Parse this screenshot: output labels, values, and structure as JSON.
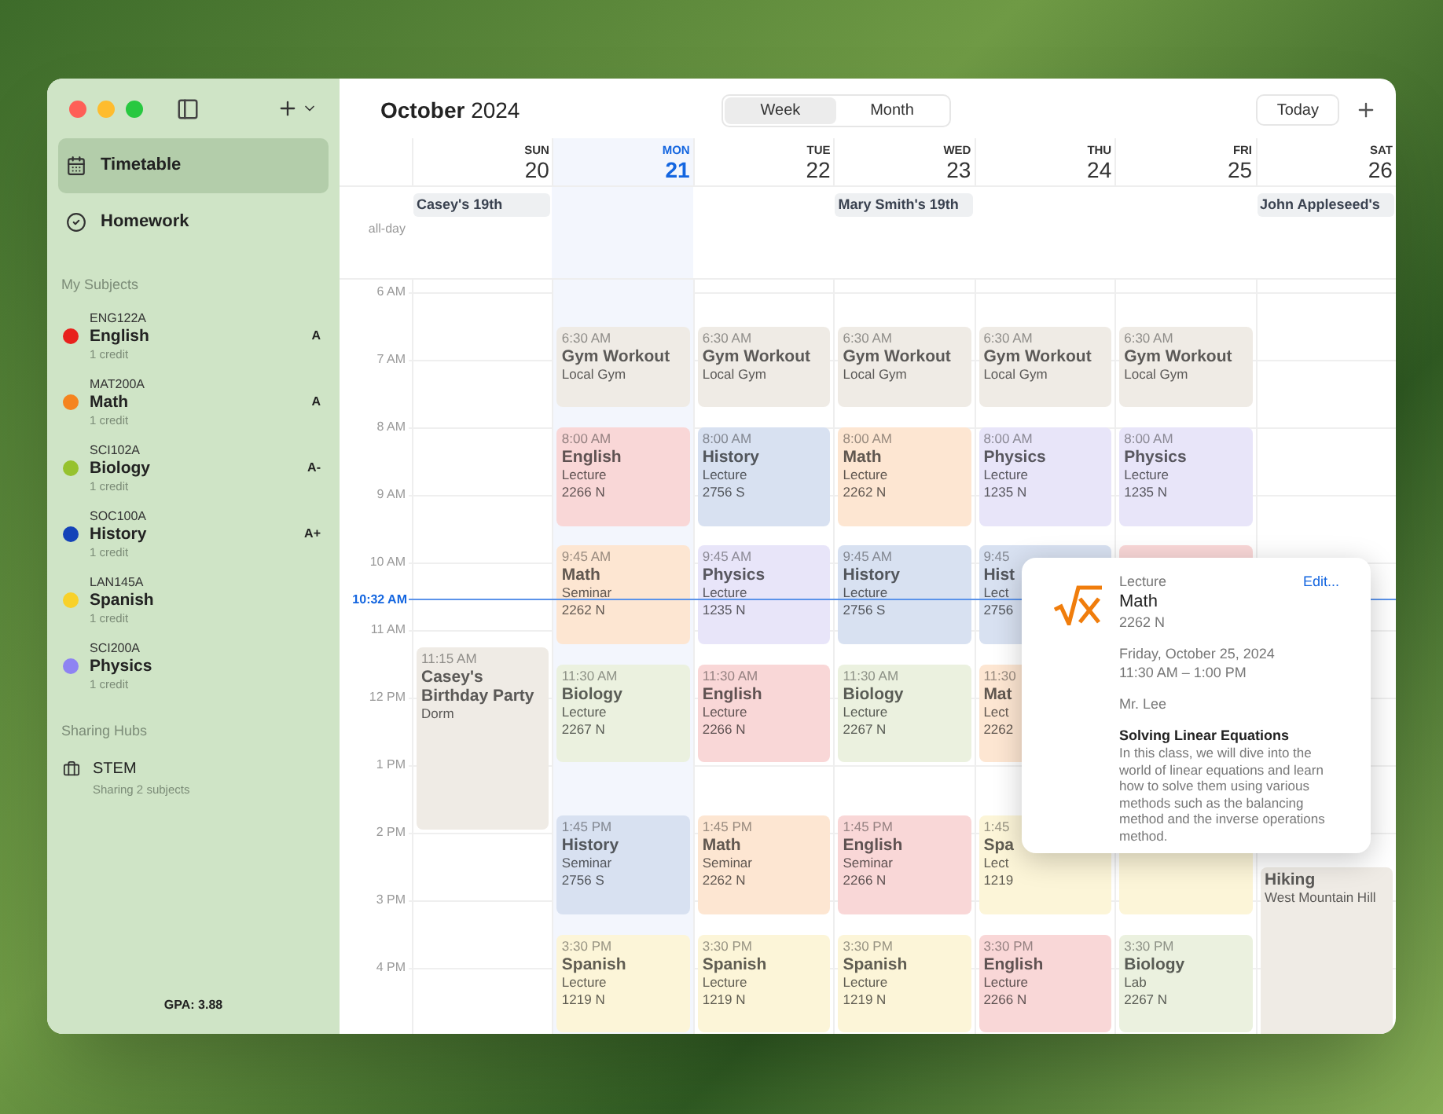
{
  "sidebar": {
    "items": [
      {
        "label": "Timetable",
        "selected": true
      },
      {
        "label": "Homework",
        "selected": false
      }
    ],
    "subjects_heading": "My Subjects",
    "subjects": [
      {
        "code": "ENG122A",
        "name": "English",
        "credit": "1 credit",
        "grade": "A",
        "color": "#e8211c"
      },
      {
        "code": "MAT200A",
        "name": "Math",
        "credit": "1 credit",
        "grade": "A",
        "color": "#f5841f"
      },
      {
        "code": "SCI102A",
        "name": "Biology",
        "credit": "1 credit",
        "grade": "A-",
        "color": "#96c22e"
      },
      {
        "code": "SOC100A",
        "name": "History",
        "credit": "1 credit",
        "grade": "A+",
        "color": "#1443b8"
      },
      {
        "code": "LAN145A",
        "name": "Spanish",
        "credit": "1 credit",
        "color": "#f8d12a"
      },
      {
        "code": "SCI200A",
        "name": "Physics",
        "credit": "1 credit",
        "color": "#8e83f2"
      }
    ],
    "hubs_heading": "Sharing Hubs",
    "hubs": [
      {
        "name": "STEM",
        "detail": "Sharing 2 subjects"
      }
    ],
    "gpa": "GPA: 3.88"
  },
  "title": "**October** 2024",
  "views": [
    {
      "label": "Week",
      "selected": true
    },
    {
      "label": "Month",
      "selected": false
    }
  ],
  "today_button": "Today",
  "all_day_label": "all-day",
  "hours": [
    "6 AM",
    "7 AM",
    "8 AM",
    "9 AM",
    "10 AM",
    "11 AM",
    "12 PM",
    "1 PM",
    "2 PM",
    "3 PM",
    "4 PM"
  ],
  "now_label": "10:32 AM",
  "days": [
    {
      "name": "SUN",
      "date": "20",
      "selected": false,
      "all_day": [
        "Casey's 19th"
      ],
      "events": [
        {
          "time": "11:15 AM",
          "title": "Casey's Birthday Party",
          "lines": [
            "Dorm"
          ],
          "color": "#efebe5"
        }
      ]
    },
    {
      "name": "MON",
      "date": "21",
      "selected": true,
      "events": [
        {
          "time": "6:30 AM",
          "title": "Gym Workout",
          "lines": [
            "Local Gym"
          ],
          "color": "#efebe5"
        },
        {
          "time": "8:00 AM",
          "title": "English",
          "lines": [
            "Lecture",
            "2266 N"
          ],
          "color": "#f9d7d7"
        },
        {
          "time": "9:45 AM",
          "title": "Math",
          "lines": [
            "Seminar",
            "2262 N"
          ],
          "color": "#fde6d2"
        },
        {
          "time": "11:30 AM",
          "title": "Biology",
          "lines": [
            "Lecture",
            "2267 N"
          ],
          "color": "#ebf1df"
        },
        {
          "time": "1:45 PM",
          "title": "History",
          "lines": [
            "Seminar",
            "2756 S"
          ],
          "color": "#d8e1f1"
        },
        {
          "time": "3:30 PM",
          "title": "Spanish",
          "lines": [
            "Lecture",
            "1219 N"
          ],
          "color": "#fcf5d8"
        }
      ]
    },
    {
      "name": "TUE",
      "date": "22",
      "selected": false,
      "events": [
        {
          "time": "6:30 AM",
          "title": "Gym Workout",
          "lines": [
            "Local Gym"
          ],
          "color": "#efebe5"
        },
        {
          "time": "8:00 AM",
          "title": "History",
          "lines": [
            "Lecture",
            "2756 S"
          ],
          "color": "#d8e1f1"
        },
        {
          "time": "9:45 AM",
          "title": "Physics",
          "lines": [
            "Lecture",
            "1235 N"
          ],
          "color": "#e8e5f9"
        },
        {
          "time": "11:30 AM",
          "title": "English",
          "lines": [
            "Lecture",
            "2266 N"
          ],
          "color": "#f9d7d7"
        },
        {
          "time": "1:45 PM",
          "title": "Math",
          "lines": [
            "Seminar",
            "2262 N"
          ],
          "color": "#fde6d2"
        },
        {
          "time": "3:30 PM",
          "title": "Spanish",
          "lines": [
            "Lecture",
            "1219 N"
          ],
          "color": "#fcf5d8"
        }
      ]
    },
    {
      "name": "WED",
      "date": "23",
      "selected": false,
      "all_day": [
        "Mary Smith's 19th"
      ],
      "events": [
        {
          "time": "6:30 AM",
          "title": "Gym Workout",
          "lines": [
            "Local Gym"
          ],
          "color": "#efebe5"
        },
        {
          "time": "8:00 AM",
          "title": "Math",
          "lines": [
            "Lecture",
            "2262 N"
          ],
          "color": "#fde6d2"
        },
        {
          "time": "9:45 AM",
          "title": "History",
          "lines": [
            "Lecture",
            "2756 S"
          ],
          "color": "#d8e1f1"
        },
        {
          "time": "11:30 AM",
          "title": "Biology",
          "lines": [
            "Lecture",
            "2267 N"
          ],
          "color": "#ebf1df"
        },
        {
          "time": "1:45 PM",
          "title": "English",
          "lines": [
            "Seminar",
            "2266 N"
          ],
          "color": "#f9d7d7"
        },
        {
          "time": "3:30 PM",
          "title": "Spanish",
          "lines": [
            "Lecture",
            "1219 N"
          ],
          "color": "#fcf5d8"
        }
      ]
    },
    {
      "name": "THU",
      "date": "24",
      "selected": false,
      "events": [
        {
          "time": "6:30 AM",
          "title": "Gym Workout",
          "lines": [
            "Local Gym"
          ],
          "color": "#efebe5"
        },
        {
          "time": "8:00 AM",
          "title": "Physics",
          "lines": [
            "Lecture",
            "1235 N"
          ],
          "color": "#e8e5f9"
        },
        {
          "time": "9:45",
          "title": "Hist",
          "lines": [
            "Lect",
            "2756"
          ],
          "color": "#d8e1f1"
        },
        {
          "time": "11:30",
          "title": "Mat",
          "lines": [
            "Lect",
            "2262"
          ],
          "color": "#fde6d2"
        },
        {
          "time": "1:45",
          "title": "Spa",
          "lines": [
            "Lect",
            "1219"
          ],
          "color": "#fcf5d8"
        },
        {
          "time": "3:30 PM",
          "title": "English",
          "lines": [
            "Lecture",
            "2266 N"
          ],
          "color": "#f9d7d7"
        }
      ]
    },
    {
      "name": "FRI",
      "date": "25",
      "selected": false,
      "events": [
        {
          "time": "6:30 AM",
          "title": "Gym Workout",
          "lines": [
            "Local Gym"
          ],
          "color": "#efebe5"
        },
        {
          "time": "8:00 AM",
          "title": "Physics",
          "lines": [
            "Lecture",
            "1235 N"
          ],
          "color": "#e8e5f9"
        },
        {
          "color": "#f9d7d7"
        },
        {
          "color": "#fcf5d8"
        },
        {
          "time": "3:30 PM",
          "title": "Biology",
          "lines": [
            "Lab",
            "2267 N"
          ],
          "color": "#ebf1df"
        }
      ]
    },
    {
      "name": "SAT",
      "date": "26",
      "selected": false,
      "all_day": [
        "John Appleseed's"
      ],
      "events": [
        {
          "title": "Hiking",
          "lines": [
            "West Mountain Hill"
          ],
          "color": "#efebe5"
        }
      ]
    }
  ],
  "popup": {
    "type": "Lecture",
    "edit": "Edit...",
    "subject": "Math",
    "room": "2262 N",
    "date": "Friday, October 25, 2024",
    "time": "11:30 AM – 1:00 PM",
    "teacher": "Mr. Lee",
    "topic": "Solving Linear Equations",
    "description": "In this class, we will dive into the world of linear equations and learn how to solve them using various methods such as the balancing method and the inverse operations method."
  }
}
